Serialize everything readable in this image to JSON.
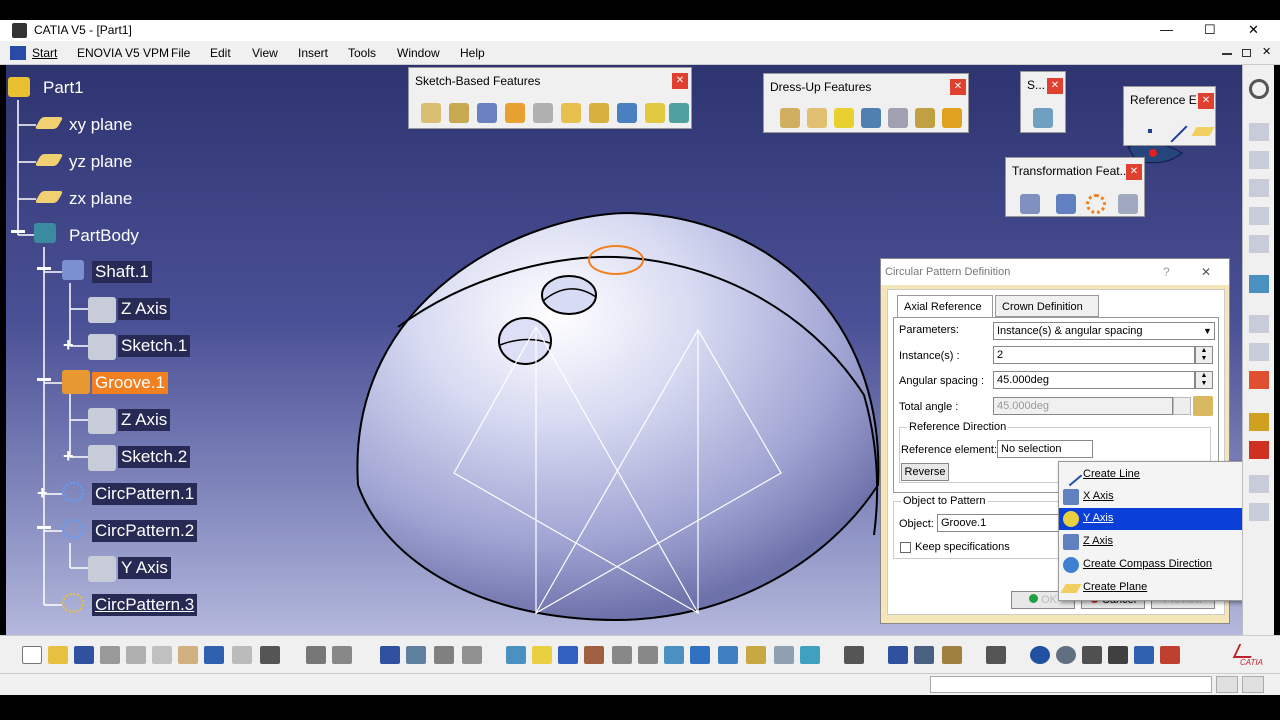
{
  "app": {
    "title": "CATIA V5 - [Part1]"
  },
  "window_controls": {
    "minimize": "—",
    "maximize": "☐",
    "close": "✕"
  },
  "menu": [
    "Start",
    "ENOVIA V5 VPM",
    "File",
    "Edit",
    "View",
    "Insert",
    "Tools",
    "Window",
    "Help"
  ],
  "tree": {
    "root": "Part1",
    "xy": "xy plane",
    "yz": "yz plane",
    "zx": "zx plane",
    "body": "PartBody",
    "shaft": "Shaft.1",
    "shaft_axis": "Z Axis",
    "sketch1": "Sketch.1",
    "groove": "Groove.1",
    "groove_axis": "Z Axis",
    "sketch2": "Sketch.2",
    "circ1": "CircPattern.1",
    "circ2": "CircPattern.2",
    "yaxis": "Y Axis",
    "circ3": "CircPattern.3"
  },
  "toolbars": {
    "sketch_based": "Sketch-Based Features",
    "dress_up": "Dress-Up Features",
    "s_short": "S...",
    "reference": "Reference E...",
    "transformation": "Transformation Feat..."
  },
  "dialog": {
    "title": "Circular Pattern Definition",
    "help": "?",
    "close": "✕",
    "tab_axial": "Axial Reference",
    "tab_crown": "Crown Definition",
    "parameters_label": "Parameters:",
    "parameters_value": "Instance(s) & angular spacing",
    "instances_label": "Instance(s) :",
    "instances_value": "2",
    "angular_label": "Angular spacing :",
    "angular_value": "45.000deg",
    "total_label": "Total angle :",
    "total_value": "45.000deg",
    "ref_dir_group": "Reference Direction",
    "ref_element_label": "Reference element:",
    "ref_element_value": "No selection",
    "reverse": "Reverse",
    "object_group": "Object to Pattern",
    "object_label": "Object:",
    "object_value": "Groove.1",
    "keep_spec": "Keep specifications",
    "ok": "OK",
    "cancel": "Cancel",
    "preview": "Preview"
  },
  "context_menu": [
    "Create Line",
    "X Axis",
    "Y Axis",
    "Z Axis",
    "Create Compass Direction",
    "Create Plane"
  ],
  "colors": {
    "selection": "#f08020",
    "menu_highlight": "#0a3fd8",
    "viewport_top": "#2e3470"
  },
  "status": {
    "logo": "CATIA"
  }
}
